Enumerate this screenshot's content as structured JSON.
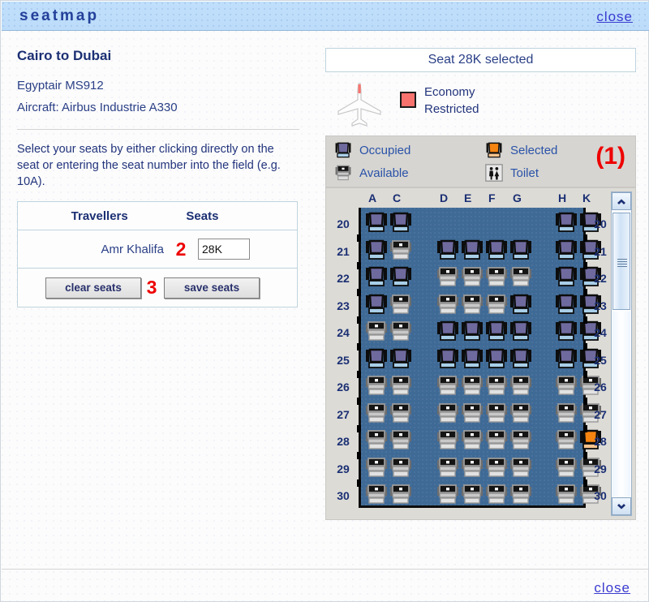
{
  "window": {
    "title": "seatmap",
    "close_top": "close",
    "close_bottom": "close"
  },
  "flight": {
    "route": "Cairo to Dubai",
    "carrier_flight": "Egyptair MS912",
    "aircraft": "Aircraft: Airbus Industrie A330"
  },
  "instructions": "Select your seats by either clicking directly on the seat or entering the seat number into the field (e.g. 10A).",
  "travellers_table": {
    "headers": [
      "Travellers",
      "Seats"
    ],
    "rows": [
      {
        "name": "Amr Khalifa",
        "seat_value": "28K",
        "seat_placeholder": "",
        "marker": "2"
      }
    ]
  },
  "actions": {
    "clear_label": "clear seats",
    "save_label": "save seats",
    "marker": "3"
  },
  "status": {
    "text": "Seat 28K selected"
  },
  "cabin_class": {
    "swatch_color": "#f8736e",
    "label_line1": "Economy",
    "label_line2": "Restricted"
  },
  "legend": {
    "marker": "(1)",
    "items": [
      {
        "key": "occupied",
        "label": "Occupied"
      },
      {
        "key": "available",
        "label": "Available"
      },
      {
        "key": "selected",
        "label": "Selected"
      },
      {
        "key": "toilet",
        "label": "Toilet"
      }
    ]
  },
  "seatmap": {
    "columns": [
      "A",
      "C",
      "D",
      "E",
      "F",
      "G",
      "H",
      "K"
    ],
    "rows": [
      {
        "number": "20",
        "seats": {
          "A": "occupied",
          "C": "occupied",
          "D": "none",
          "E": "none",
          "F": "none",
          "G": "none",
          "H": "occupied",
          "K": "occupied"
        }
      },
      {
        "number": "21",
        "seats": {
          "A": "occupied",
          "C": "available",
          "D": "occupied",
          "E": "occupied",
          "F": "occupied",
          "G": "occupied",
          "H": "occupied",
          "K": "occupied"
        }
      },
      {
        "number": "22",
        "seats": {
          "A": "occupied",
          "C": "occupied",
          "D": "available",
          "E": "available",
          "F": "available",
          "G": "available",
          "H": "occupied",
          "K": "occupied"
        }
      },
      {
        "number": "23",
        "seats": {
          "A": "occupied",
          "C": "available",
          "D": "available",
          "E": "available",
          "F": "available",
          "G": "occupied",
          "H": "occupied",
          "K": "occupied"
        }
      },
      {
        "number": "24",
        "seats": {
          "A": "available",
          "C": "available",
          "D": "occupied",
          "E": "occupied",
          "F": "occupied",
          "G": "occupied",
          "H": "occupied",
          "K": "occupied"
        }
      },
      {
        "number": "25",
        "seats": {
          "A": "occupied",
          "C": "occupied",
          "D": "occupied",
          "E": "occupied",
          "F": "occupied",
          "G": "occupied",
          "H": "occupied",
          "K": "occupied"
        }
      },
      {
        "number": "26",
        "seats": {
          "A": "available",
          "C": "available",
          "D": "available",
          "E": "available",
          "F": "available",
          "G": "available",
          "H": "available",
          "K": "available"
        }
      },
      {
        "number": "27",
        "seats": {
          "A": "available",
          "C": "available",
          "D": "available",
          "E": "available",
          "F": "available",
          "G": "available",
          "H": "available",
          "K": "available"
        }
      },
      {
        "number": "28",
        "seats": {
          "A": "available",
          "C": "available",
          "D": "available",
          "E": "available",
          "F": "available",
          "G": "available",
          "H": "available",
          "K": "selected"
        }
      },
      {
        "number": "29",
        "seats": {
          "A": "available",
          "C": "available",
          "D": "available",
          "E": "available",
          "F": "available",
          "G": "available",
          "H": "available",
          "K": "available"
        }
      },
      {
        "number": "30",
        "seats": {
          "A": "available",
          "C": "available",
          "D": "available",
          "E": "available",
          "F": "available",
          "G": "available",
          "H": "available",
          "K": "available"
        }
      }
    ],
    "selected_seat": "28K"
  },
  "colors": {
    "occupied": "#6f6a9e",
    "occupied_cushion": "#a9cfe8",
    "available": "#c8c8c8",
    "available_band": "#141414",
    "selected": "#f58410",
    "selected_cushion": "#f9c48e",
    "cabin_floor": "#3f6a96",
    "accent_red": "#ee0000",
    "title_bar": "#bfdffb",
    "link": "#3b3bd0"
  },
  "scrollbar": {
    "up_arrow": "▲",
    "down_arrow": "▼"
  }
}
